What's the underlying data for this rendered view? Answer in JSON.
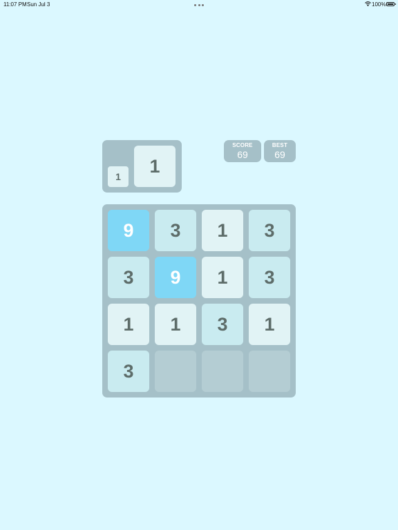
{
  "status_bar": {
    "time": "11:07 PM",
    "date": "Sun Jul 3",
    "battery": "100%"
  },
  "next_tiles": {
    "small": "1",
    "large": "1"
  },
  "scoreboard": {
    "score_label": "SCORE",
    "score_value": "69",
    "best_label": "BEST",
    "best_value": "69"
  },
  "board": {
    "rows": [
      [
        "9",
        "3",
        "1",
        "3"
      ],
      [
        "3",
        "9",
        "1",
        "3"
      ],
      [
        "1",
        "1",
        "3",
        "1"
      ],
      [
        "3",
        "",
        "",
        ""
      ]
    ]
  }
}
